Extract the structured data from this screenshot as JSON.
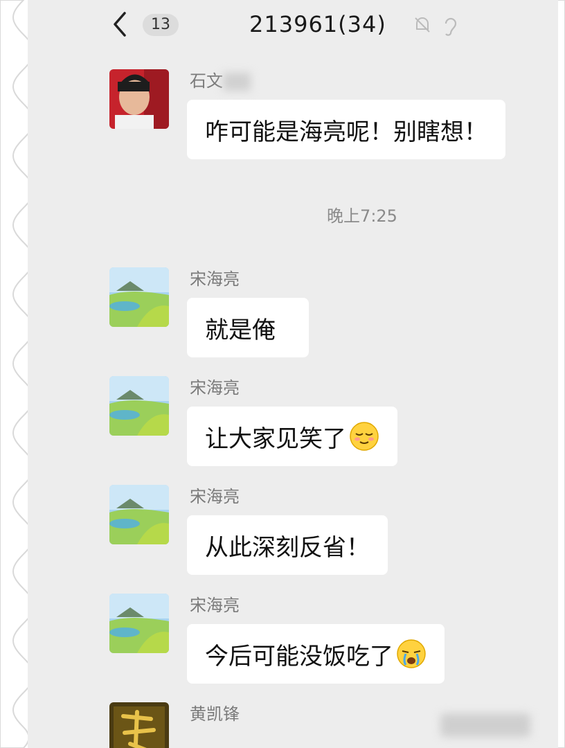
{
  "header": {
    "back_count": "13",
    "title": "213961(34)",
    "icons": [
      "back-arrow-icon",
      "mute-bell-icon",
      "ear-icon"
    ]
  },
  "messages": [
    {
      "sender": "石文",
      "text": "咋可能是海亮呢！别瞎想！",
      "avatar": "child-photo"
    },
    {
      "sender": "宋海亮",
      "text": "就是俺",
      "avatar": "landscape"
    },
    {
      "sender": "宋海亮",
      "text": "让大家见笑了",
      "emoji": "relieved-emoji",
      "avatar": "landscape"
    },
    {
      "sender": "宋海亮",
      "text": "从此深刻反省！",
      "avatar": "landscape"
    },
    {
      "sender": "宋海亮",
      "text": "今后可能没饭吃了",
      "emoji": "crying-emoji",
      "avatar": "landscape"
    },
    {
      "sender": "黄凯锋",
      "text": "",
      "avatar": "gold-calligraphy"
    }
  ],
  "timestamp": "晚上7:25",
  "colors": {
    "chat_background": "#ededed",
    "bubble": "#ffffff",
    "name": "#7a7a7a",
    "time": "#8a8a8a"
  }
}
